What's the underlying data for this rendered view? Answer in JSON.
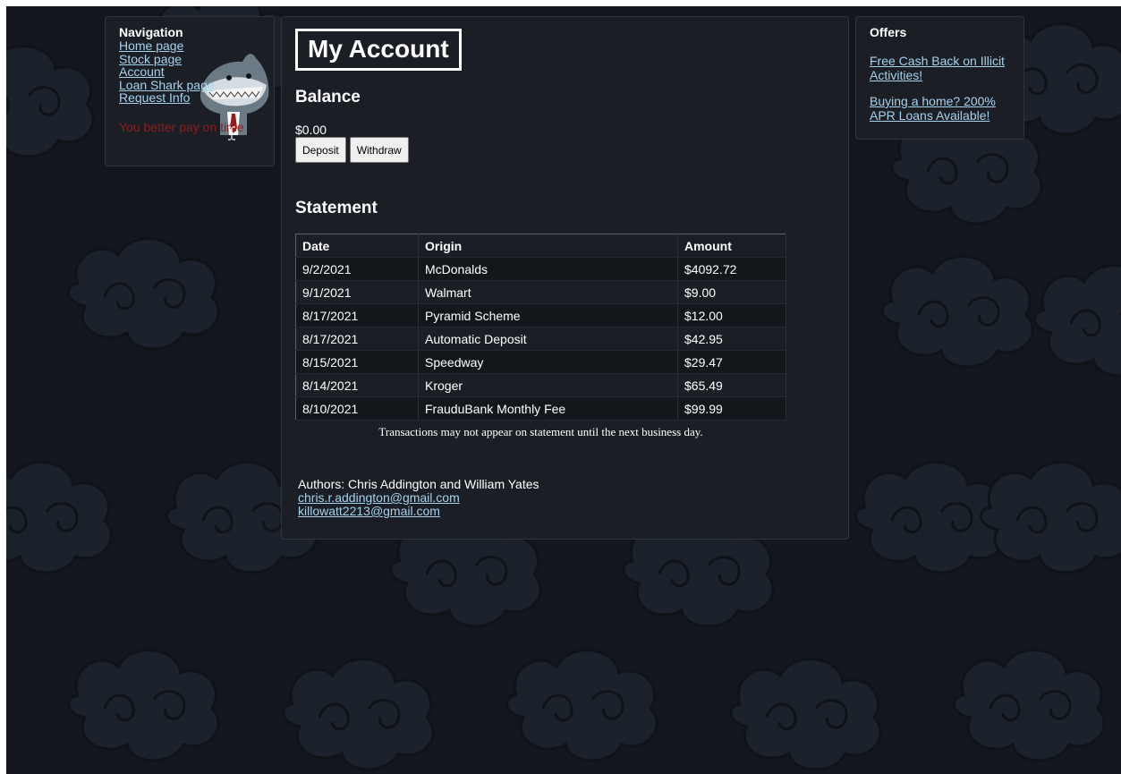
{
  "navigation": {
    "title": "Navigation",
    "links": [
      "Home page",
      "Stock page",
      "Account",
      "Loan Shark page",
      "Request Info"
    ],
    "warning": "You better pay on time"
  },
  "main": {
    "title": "My Account",
    "balance_heading": "Balance",
    "balance_amount": "$0.00",
    "deposit_label": "Deposit",
    "withdraw_label": "Withdraw",
    "statement_heading": "Statement",
    "table": {
      "headers": [
        "Date",
        "Origin",
        "Amount"
      ],
      "rows": [
        [
          "9/2/2021",
          "McDonalds",
          "$4092.72"
        ],
        [
          "9/1/2021",
          "Walmart",
          "$9.00"
        ],
        [
          "8/17/2021",
          "Pyramid Scheme",
          "$12.00"
        ],
        [
          "8/17/2021",
          "Automatic Deposit",
          "$42.95"
        ],
        [
          "8/15/2021",
          "Speedway",
          "$29.47"
        ],
        [
          "8/14/2021",
          "Kroger",
          "$65.49"
        ],
        [
          "8/10/2021",
          "FrauduBank Monthly Fee",
          "$99.99"
        ]
      ]
    },
    "table_note": "Transactions may not appear on statement until the next business day.",
    "authors": "Authors: Chris Addington and William Yates",
    "emails": [
      "chris.r.addington@gmail.com",
      "killowatt2213@gmail.com"
    ]
  },
  "offers": {
    "title": "Offers",
    "links": [
      "Free Cash Back on Illicit Activities!",
      "Buying a home? 200% APR Loans Available!"
    ]
  },
  "colors": {
    "background": "#13171d",
    "panel": "#1b1f25",
    "link": "#a5d2ef",
    "warning": "#8f1d1d"
  }
}
